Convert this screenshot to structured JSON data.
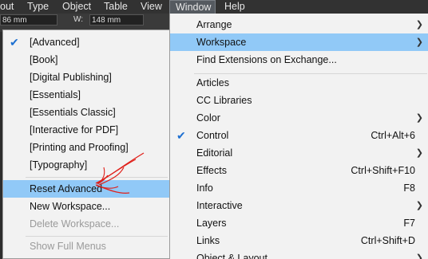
{
  "menubar": {
    "items": [
      "out",
      "Type",
      "Object",
      "Table",
      "View",
      "Window",
      "Help"
    ]
  },
  "control": {
    "x_value": "86 mm",
    "w_label": "W:",
    "w_value": "148 mm"
  },
  "workspace_submenu": {
    "items": [
      {
        "label": "[Advanced]",
        "checked": true
      },
      {
        "label": "[Book]"
      },
      {
        "label": "[Digital Publishing]"
      },
      {
        "label": "[Essentials]"
      },
      {
        "label": "[Essentials Classic]"
      },
      {
        "label": "[Interactive for PDF]"
      },
      {
        "label": "[Printing and Proofing]"
      },
      {
        "label": "[Typography]"
      }
    ],
    "reset": "Reset Advanced",
    "new_ws": "New Workspace...",
    "delete_ws": "Delete Workspace...",
    "show_full": "Show Full Menus"
  },
  "window_menu": {
    "arrange": "Arrange",
    "workspace": "Workspace",
    "find_ext": "Find Extensions on Exchange...",
    "items": [
      {
        "label": "Articles",
        "shortcut": ""
      },
      {
        "label": "CC Libraries",
        "shortcut": ""
      },
      {
        "label": "Color",
        "shortcut": ""
      },
      {
        "label": "Control",
        "shortcut": "Ctrl+Alt+6"
      },
      {
        "label": "Editorial",
        "shortcut": ""
      },
      {
        "label": "Effects",
        "shortcut": "Ctrl+Shift+F10"
      },
      {
        "label": "Info",
        "shortcut": "F8"
      },
      {
        "label": "Interactive",
        "shortcut": ""
      },
      {
        "label": "Layers",
        "shortcut": "F7"
      },
      {
        "label": "Links",
        "shortcut": "Ctrl+Shift+D"
      },
      {
        "label": "Object & Layout",
        "shortcut": ""
      }
    ]
  },
  "colors": {
    "highlight": "#91c9f7",
    "check": "#1c6fd1",
    "annotation": "#e0201a"
  }
}
